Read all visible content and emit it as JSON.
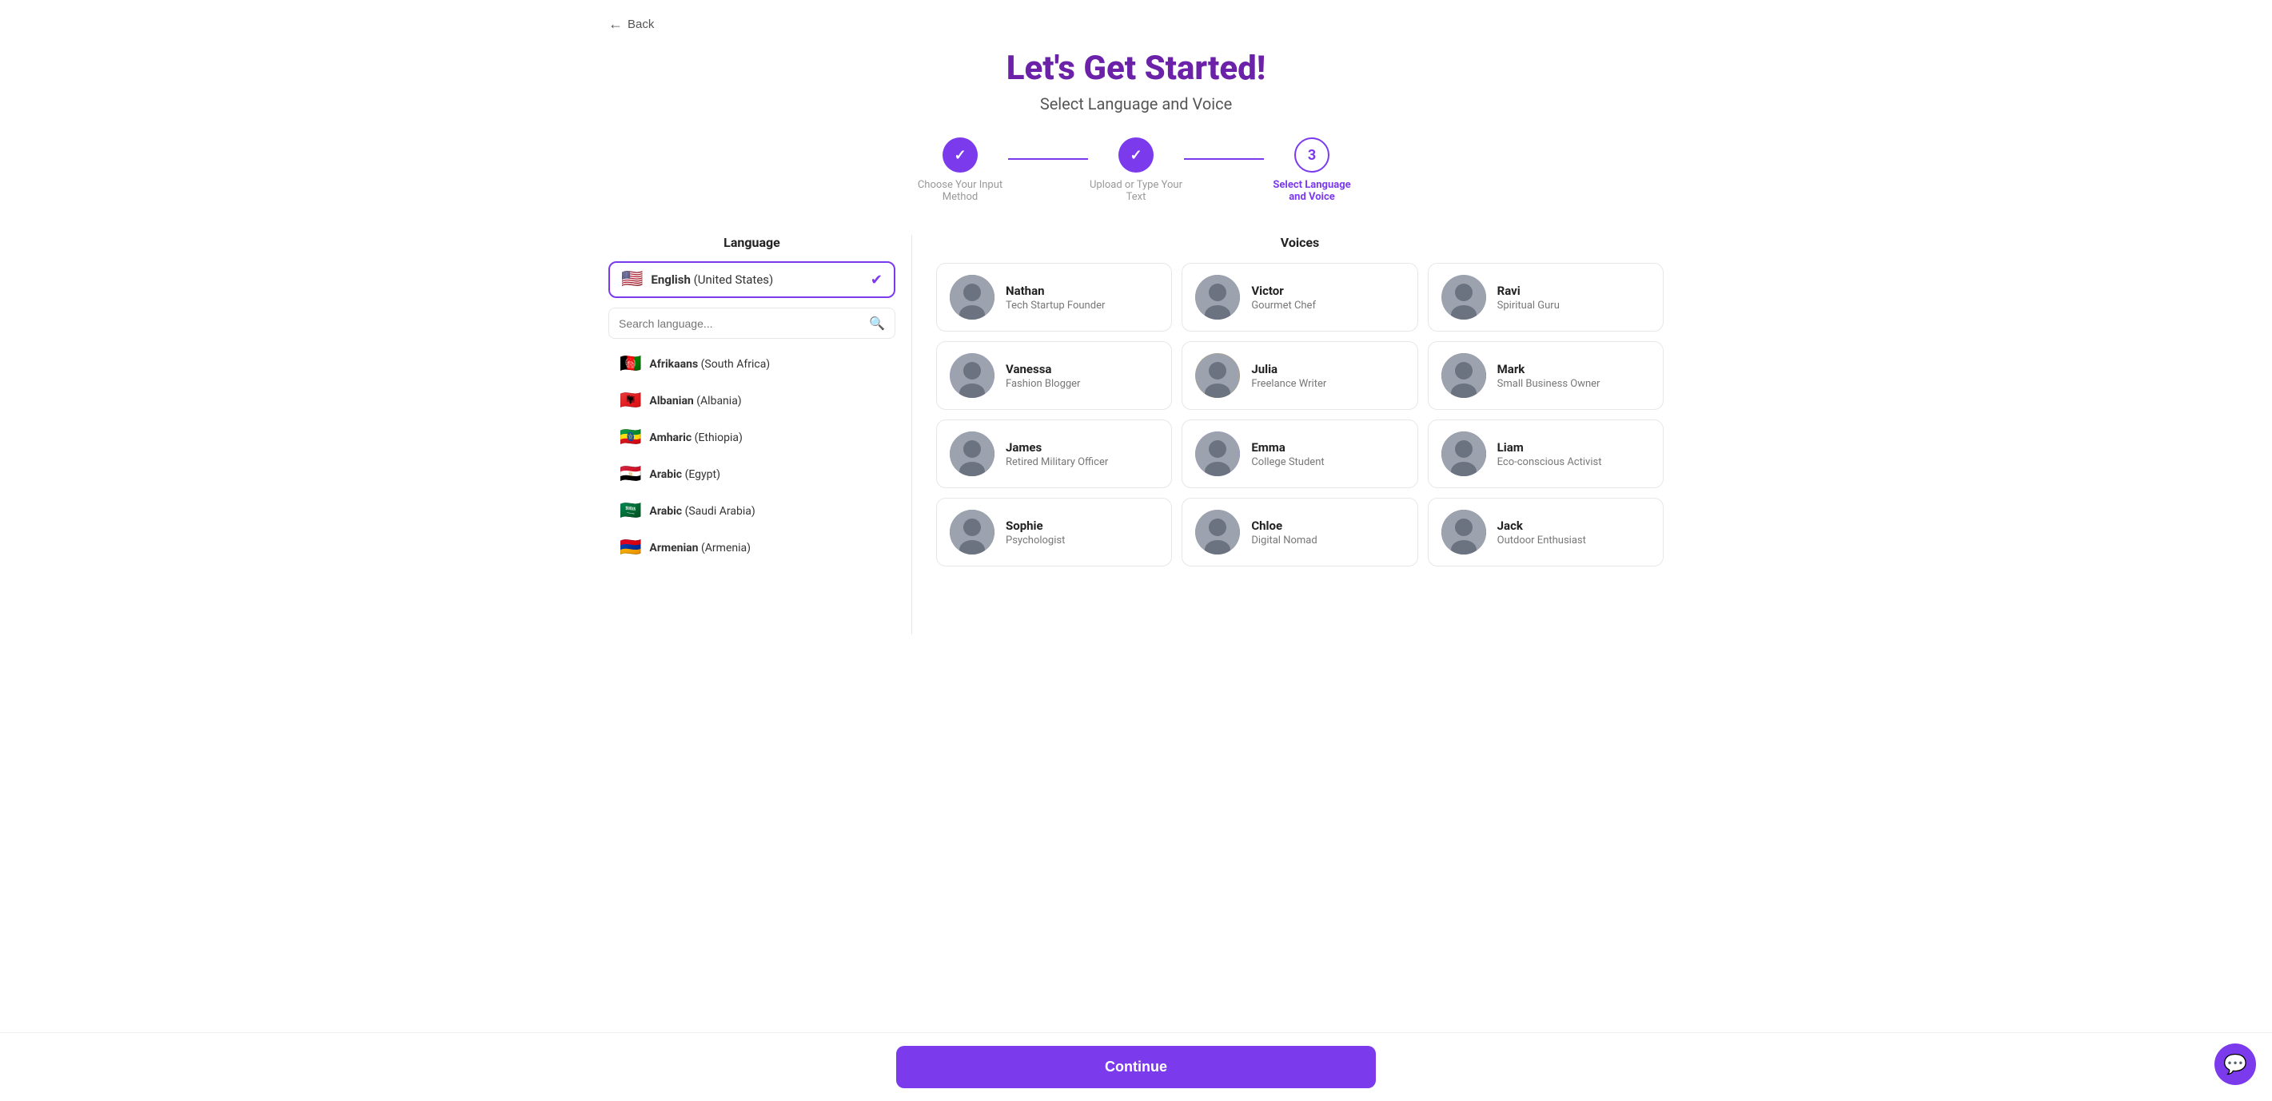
{
  "back": {
    "label": "Back"
  },
  "header": {
    "title": "Let's Get Started!",
    "subtitle": "Select Language and Voice"
  },
  "stepper": {
    "steps": [
      {
        "id": 1,
        "label": "Choose Your Input Method",
        "state": "done"
      },
      {
        "id": 2,
        "label": "Upload or Type Your Text",
        "state": "done"
      },
      {
        "id": 3,
        "label": "Select Language and Voice",
        "state": "active"
      }
    ]
  },
  "language_panel": {
    "title": "Language",
    "selected": {
      "flag": "🇺🇸",
      "name": "English",
      "region": "(United States)"
    },
    "search_placeholder": "Search language...",
    "languages": [
      {
        "flag": "🇦🇫",
        "name": "Afrikaans",
        "region": "(South Africa)"
      },
      {
        "flag": "🇦🇱",
        "name": "Albanian",
        "region": "(Albania)"
      },
      {
        "flag": "🇪🇹",
        "name": "Amharic",
        "region": "(Ethiopia)"
      },
      {
        "flag": "🇪🇬",
        "name": "Arabic",
        "region": "(Egypt)"
      },
      {
        "flag": "🇸🇦",
        "name": "Arabic",
        "region": "(Saudi Arabia)"
      },
      {
        "flag": "🇦🇲",
        "name": "Armenian",
        "region": "(Armenia)"
      }
    ]
  },
  "voice_panel": {
    "title": "Voices",
    "voices": [
      {
        "id": "nathan",
        "name": "Nathan",
        "role": "Tech Startup Founder",
        "avatar_class": "av-nathan",
        "emoji": "👤"
      },
      {
        "id": "victor",
        "name": "Victor",
        "role": "Gourmet Chef",
        "avatar_class": "av-victor",
        "emoji": "👤"
      },
      {
        "id": "ravi",
        "name": "Ravi",
        "role": "Spiritual Guru",
        "avatar_class": "av-ravi",
        "emoji": "👤"
      },
      {
        "id": "vanessa",
        "name": "Vanessa",
        "role": "Fashion Blogger",
        "avatar_class": "av-vanessa",
        "emoji": "👤"
      },
      {
        "id": "julia",
        "name": "Julia",
        "role": "Freelance Writer",
        "avatar_class": "av-julia",
        "emoji": "👤"
      },
      {
        "id": "mark",
        "name": "Mark",
        "role": "Small Business Owner",
        "avatar_class": "av-mark",
        "emoji": "👤"
      },
      {
        "id": "james",
        "name": "James",
        "role": "Retired Military Officer",
        "avatar_class": "av-james",
        "emoji": "👤"
      },
      {
        "id": "emma",
        "name": "Emma",
        "role": "College Student",
        "avatar_class": "av-emma",
        "emoji": "👤"
      },
      {
        "id": "liam",
        "name": "Liam",
        "role": "Eco-conscious Activist",
        "avatar_class": "av-liam",
        "emoji": "👤"
      },
      {
        "id": "sophie",
        "name": "Sophie",
        "role": "Psychologist",
        "avatar_class": "av-sophie",
        "emoji": "👤"
      },
      {
        "id": "chloe",
        "name": "Chloe",
        "role": "Digital Nomad",
        "avatar_class": "av-chloe",
        "emoji": "👤"
      },
      {
        "id": "jack",
        "name": "Jack",
        "role": "Outdoor Enthusiast",
        "avatar_class": "av-jack",
        "emoji": "👤"
      }
    ]
  },
  "continue_btn": {
    "label": "Continue"
  },
  "chat": {
    "icon": "💬"
  }
}
